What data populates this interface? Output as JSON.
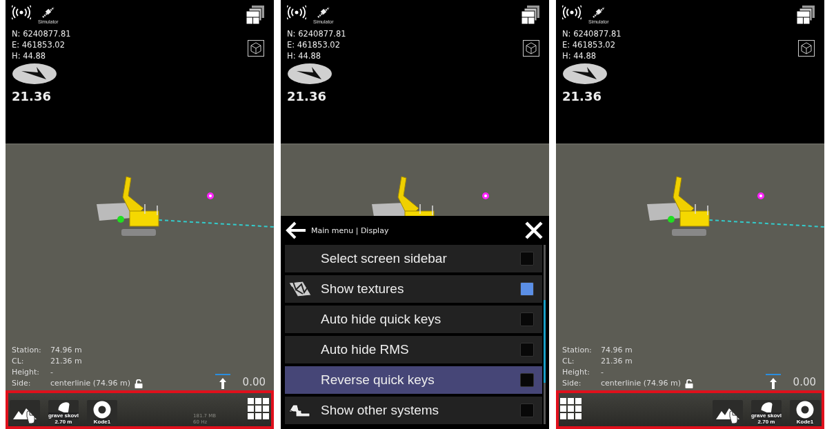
{
  "screens": [
    {
      "gnss_label": "Simulator",
      "coords": [
        "N: 6240877.81",
        "E: 461853.02",
        "H: 44.88"
      ],
      "heading": "21.36",
      "info": [
        {
          "label": "Station:",
          "value": "74.96 m",
          "locked": false
        },
        {
          "label": "CL:",
          "value": "21.36 m",
          "locked": false
        },
        {
          "label": "Height:",
          "value": "-",
          "locked": false
        },
        {
          "label": "Side:",
          "value": "centerlinie (74.96 m)",
          "locked": true
        }
      ],
      "elevation": "0.00",
      "toolbar": {
        "buttons": [
          {
            "kind": "terrain"
          },
          {
            "kind": "bucket",
            "label": "grave skovl",
            "value": "2.70 m"
          },
          {
            "kind": "code",
            "label": "Kode1"
          },
          {
            "kind": "grid"
          }
        ],
        "stats": [
          "181.7 MB",
          "60 Hz"
        ]
      }
    },
    {
      "gnss_label": "Simulator",
      "coords": [
        "N: 6240877.81",
        "E: 461853.02",
        "H: 44.88"
      ],
      "heading": "21.36",
      "menu": {
        "breadcrumb": "Main menu | Display",
        "items": [
          {
            "kind": "plain",
            "label": "Select screen sidebar",
            "checked": false,
            "selected": false
          },
          {
            "kind": "texture",
            "label": "Show textures",
            "checked": true,
            "selected": false
          },
          {
            "kind": "plain",
            "label": "Auto hide quick keys",
            "checked": false,
            "selected": false
          },
          {
            "kind": "plain",
            "label": "Auto hide RMS",
            "checked": false,
            "selected": false
          },
          {
            "kind": "plain",
            "label": "Reverse quick keys",
            "checked": false,
            "selected": true
          },
          {
            "kind": "machine",
            "label": "Show other systems",
            "checked": false,
            "selected": false
          }
        ]
      }
    },
    {
      "gnss_label": "Simulator",
      "coords": [
        "N: 6240877.81",
        "E: 461853.02",
        "H: 44.88"
      ],
      "heading": "21.36",
      "info": [
        {
          "label": "Station:",
          "value": "74.96 m",
          "locked": false
        },
        {
          "label": "CL:",
          "value": "21.36 m",
          "locked": false
        },
        {
          "label": "Height:",
          "value": "-",
          "locked": false
        },
        {
          "label": "Side:",
          "value": "centerlinie (74.96 m)",
          "locked": true
        }
      ],
      "elevation": "0.00",
      "toolbar": {
        "buttons": [
          {
            "kind": "grid"
          },
          {
            "kind": "terrain"
          },
          {
            "kind": "bucket",
            "label": "grave skovl",
            "value": "2.70 m"
          },
          {
            "kind": "code",
            "label": "Kode1"
          }
        ]
      }
    }
  ]
}
